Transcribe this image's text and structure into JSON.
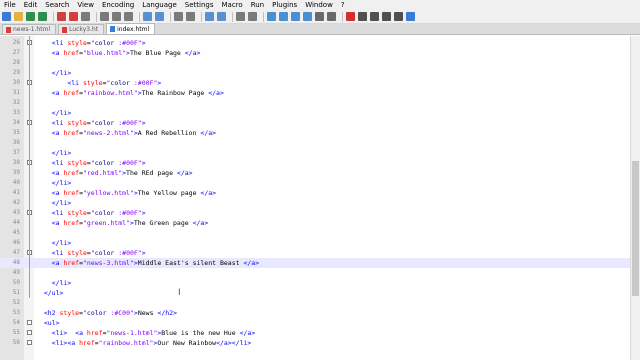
{
  "menu": [
    "File",
    "Edit",
    "Search",
    "View",
    "Encoding",
    "Language",
    "Settings",
    "Macro",
    "Run",
    "Plugins",
    "Window",
    "?"
  ],
  "tabs": [
    {
      "label": "news-1.html",
      "active": false
    },
    {
      "label": "Lucky3.ht",
      "active": false
    },
    {
      "label": "index.html",
      "active": true
    }
  ],
  "toolbar_icons": [
    "new-file-icon",
    "open-file-icon",
    "save-icon",
    "save-all-icon",
    "close-icon",
    "close-all-icon",
    "print-icon",
    "cut-icon",
    "copy-icon",
    "paste-icon",
    "undo-icon",
    "redo-icon",
    "find-icon",
    "replace-icon",
    "zoom-in-icon",
    "zoom-out-icon",
    "sync-v-icon",
    "sync-h-icon",
    "wrap-icon",
    "all-chars-icon",
    "indent-guide-icon",
    "udl-icon",
    "doc-map-icon",
    "function-list-icon",
    "record-macro-icon",
    "stop-macro-icon",
    "play-macro-icon",
    "run-multi-macro-icon",
    "save-macro-icon",
    "spellcheck-icon"
  ],
  "lines": [
    {
      "n": "26",
      "text": "    <li style=\"color :#00F\">"
    },
    {
      "n": "27",
      "text": "    <a href=\"blue.html\">The Blue Page </a>"
    },
    {
      "n": "28",
      "text": ""
    },
    {
      "n": "29",
      "text": "    </li>"
    },
    {
      "n": "30",
      "text": "        <li style=\"color :#00F\">"
    },
    {
      "n": "31",
      "text": "    <a href=\"rainbow.html\">The Rainbow Page </a>"
    },
    {
      "n": "32",
      "text": ""
    },
    {
      "n": "33",
      "text": "    </li>"
    },
    {
      "n": "34",
      "text": "    <li style=\"color :#00F\">"
    },
    {
      "n": "35",
      "text": "    <a href=\"news-2.html\">A Red Rebellion </a>"
    },
    {
      "n": "36",
      "text": ""
    },
    {
      "n": "37",
      "text": "    </li>"
    },
    {
      "n": "38",
      "text": "    <li style=\"color :#00F\">"
    },
    {
      "n": "39",
      "text": "    <a href=\"red.html\">The REd page </a>"
    },
    {
      "n": "40",
      "text": "    </li>"
    },
    {
      "n": "41",
      "text": "    <a href=\"yellow.html\">The Yellow page </a>"
    },
    {
      "n": "42",
      "text": "    </li>"
    },
    {
      "n": "43",
      "text": "    <li style=\"color :#00F\">"
    },
    {
      "n": "44",
      "text": "    <a href=\"green.html\">The Green page </a>"
    },
    {
      "n": "45",
      "text": ""
    },
    {
      "n": "46",
      "text": "    </li>"
    },
    {
      "n": "47",
      "text": "    <li style=\"color :#00F\">"
    },
    {
      "n": "48",
      "text": "    <a href=\"news-3.html\">Middle East's silent Beast </a>"
    },
    {
      "n": "49",
      "text": ""
    },
    {
      "n": "50",
      "text": "    </li>"
    },
    {
      "n": "51",
      "text": "  </ul>"
    },
    {
      "n": "52",
      "text": ""
    },
    {
      "n": "53",
      "text": "  <h2 style=\"color :#C00\">News </h2>"
    },
    {
      "n": "54",
      "text": "  <ul>"
    },
    {
      "n": "55",
      "text": "    <li>  <a href=\"news-1.html\">Blue is the new Hue </a>"
    },
    {
      "n": "56",
      "text": "    <li><a href=\"rainbow.html\">Our New Rainbow</a></li>"
    }
  ],
  "current_line": "48",
  "colors": {
    "tag": "#0000ff",
    "attr": "#ff0000",
    "value": "#8000ff",
    "current_line_bg": "#e8e8ff"
  }
}
